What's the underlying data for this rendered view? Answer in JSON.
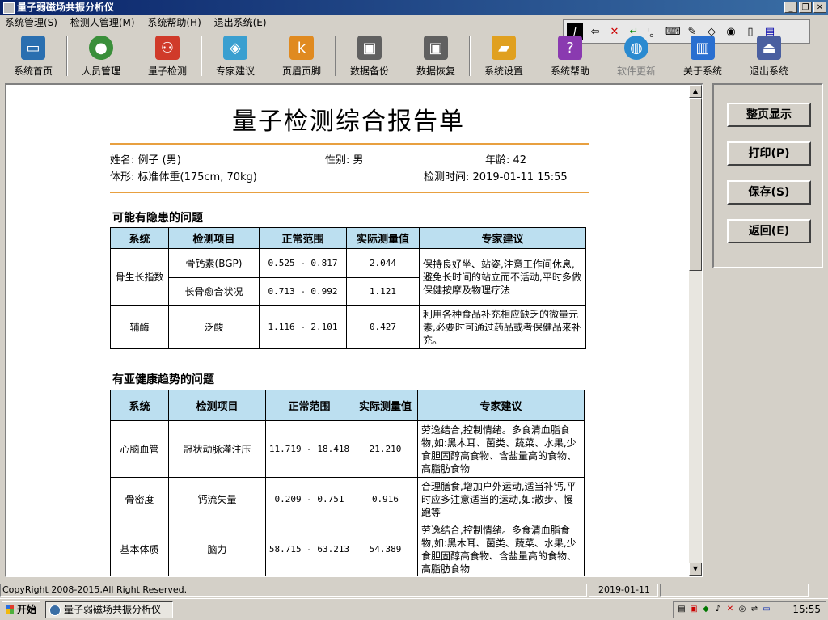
{
  "window": {
    "title": "量子弱磁场共振分析仪"
  },
  "menu": [
    {
      "label": "系统管理(S)"
    },
    {
      "label": "检测人管理(M)"
    },
    {
      "label": "系统帮助(H)"
    },
    {
      "label": "退出系统(E)"
    }
  ],
  "toolbar": [
    {
      "label": "系统首页",
      "icon": "monitor-icon",
      "color": "#2a6fb0"
    },
    {
      "label": "人员管理",
      "icon": "people-icon",
      "color": "#3a8f3a"
    },
    {
      "label": "量子检测",
      "icon": "network-icon",
      "color": "#d03a2a"
    },
    {
      "label": "专家建议",
      "icon": "book-icon",
      "color": "#3a9fd0"
    },
    {
      "label": "页眉页脚",
      "icon": "page-icon",
      "color": "#e08a20"
    },
    {
      "label": "数据备份",
      "icon": "disk-backup-icon",
      "color": "#606060"
    },
    {
      "label": "数据恢复",
      "icon": "disk-restore-icon",
      "color": "#606060"
    },
    {
      "label": "系统设置",
      "icon": "folder-settings-icon",
      "color": "#e0a020"
    },
    {
      "label": "系统帮助",
      "icon": "help-book-icon",
      "color": "#8a3ab0"
    },
    {
      "label": "软件更新",
      "icon": "globe-icon",
      "color": "#2a8ad0",
      "disabled": true
    },
    {
      "label": "关于系统",
      "icon": "chart-icon",
      "color": "#2a6fd0"
    },
    {
      "label": "退出系统",
      "icon": "exit-icon",
      "color": "#4a5fa0"
    }
  ],
  "report": {
    "title": "量子检测综合报告单",
    "name": "姓名: 例子 (男)",
    "gender": "性别: 男",
    "age": "年龄: 42",
    "body_type": "体形: 标准体重(175cm, 70kg)",
    "test_time": "检测时间: 2019-01-11 15:55",
    "section1": {
      "title": "可能有隐患的问题",
      "headers": [
        "系统",
        "检测项目",
        "正常范围",
        "实际测量值",
        "专家建议"
      ],
      "rows": [
        {
          "system": "骨生长指数",
          "item": "骨钙素(BGP)",
          "range": "0.525 - 0.817",
          "value": "2.044",
          "advice": "保持良好坐、站姿,注意工作间休息,避免长时间的站立而不活动,平时多做保健按摩及物理疗法"
        },
        {
          "item": "长骨愈合状况",
          "range": "0.713 - 0.992",
          "value": "1.121"
        },
        {
          "system": "辅酶",
          "item": "泛酸",
          "range": "1.116 - 2.101",
          "value": "0.427",
          "advice": "利用各种食品补充相应缺乏的微量元素,必要时可通过药品或者保健品来补充。"
        }
      ]
    },
    "section2": {
      "title": "有亚健康趋势的问题",
      "headers": [
        "系统",
        "检测项目",
        "正常范围",
        "实际测量值",
        "专家建议"
      ],
      "rows": [
        {
          "system": "心脑血管",
          "item": "冠状动脉灌注压",
          "range": "11.719 - 18.418",
          "value": "21.210",
          "advice": "劳逸结合,控制情绪。多食清血脂食物,如:黑木耳、菌类、蔬菜、水果,少食胆固醇高食物、含盐量高的食物、高脂肪食物"
        },
        {
          "system": "骨密度",
          "item": "钙流失量",
          "range": "0.209 - 0.751",
          "value": "0.916",
          "advice": "合理膳食,增加户外运动,适当补钙,平时应多注意适当的运动,如:散步、慢跑等"
        },
        {
          "system": "基本体质",
          "item": "脑力",
          "range": "58.715 - 63.213",
          "value": "54.389",
          "advice": "劳逸结合,控制情绪。多食清血脂食物,如:黑木耳、菌类、蔬菜、水果,少食胆固醇高食物、含盐量高的食物、高脂肪食物"
        }
      ]
    }
  },
  "side_buttons": [
    {
      "label": "整页显示"
    },
    {
      "label": "打印(P)"
    },
    {
      "label": "保存(S)"
    },
    {
      "label": "返回(E)"
    }
  ],
  "status": {
    "copyright": "CopyRight 2008-2015,All Right Reserved.",
    "date": "2019-01-11"
  },
  "taskbar": {
    "start": "开始",
    "task": "量子弱磁场共振分析仪",
    "clock": "15:55"
  }
}
